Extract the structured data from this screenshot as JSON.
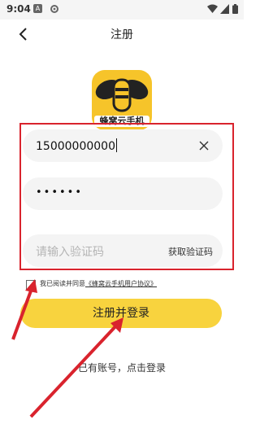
{
  "status_bar": {
    "time": "9:04",
    "app_badge": "A"
  },
  "header": {
    "title": "注册"
  },
  "logo": {
    "caption": "蜂窝云手机"
  },
  "form": {
    "phone_value": "15000000000",
    "password_mask": "••••••",
    "code_placeholder": "请输入验证码",
    "get_code_label": "获取验证码"
  },
  "agreement": {
    "prefix": "我已阅读并同意",
    "link": "《蜂窝云手机用户协议》"
  },
  "submit_label": "注册并登录",
  "login_prompt": "已有账号，点击登录",
  "colors": {
    "accent": "#f8d33e",
    "annotation": "#d9232d"
  }
}
